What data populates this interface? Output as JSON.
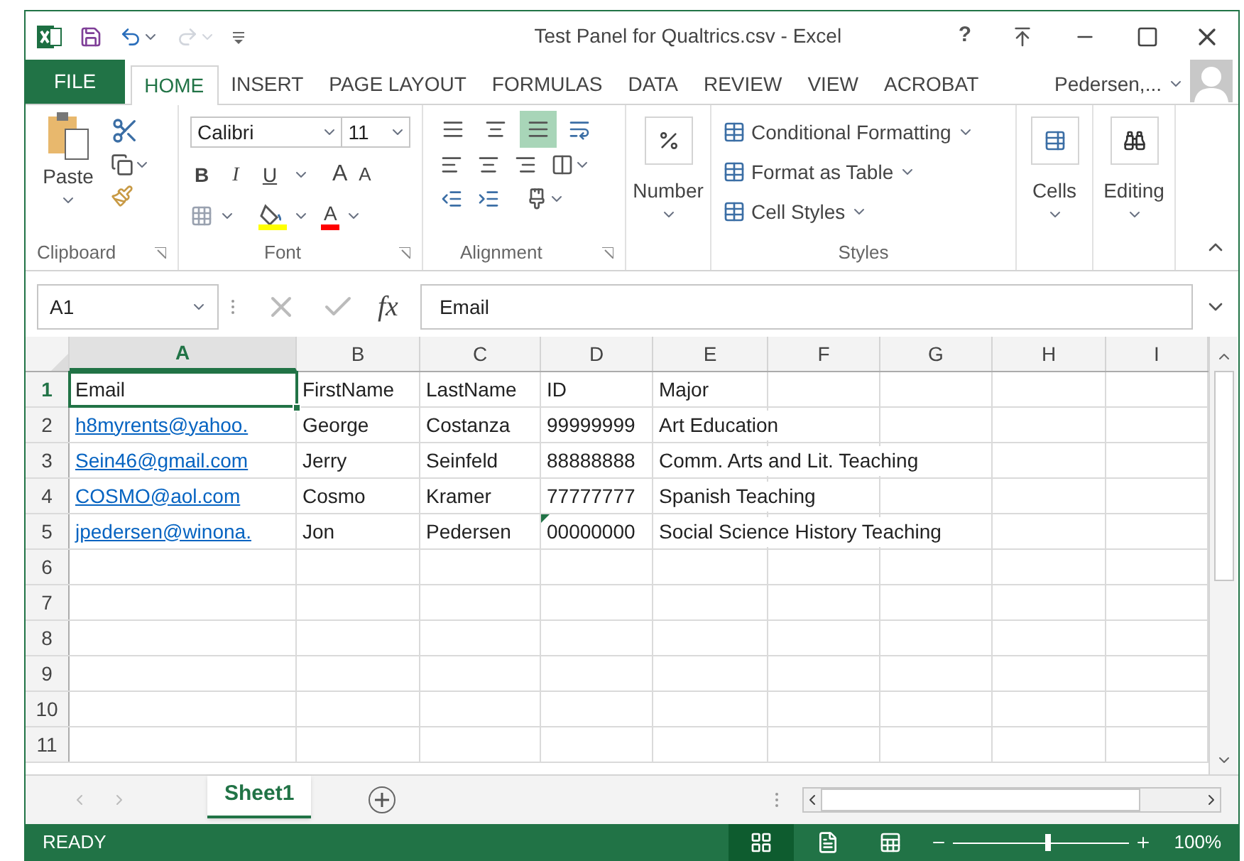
{
  "window": {
    "title": "Test Panel for Qualtrics.csv - Excel",
    "help": "?"
  },
  "ribbon_tabs": [
    {
      "label": "FILE",
      "kind": "file",
      "selected": false
    },
    {
      "label": "HOME",
      "kind": "tab",
      "selected": true
    },
    {
      "label": "INSERT",
      "kind": "tab",
      "selected": false
    },
    {
      "label": "PAGE LAYOUT",
      "kind": "tab",
      "selected": false
    },
    {
      "label": "FORMULAS",
      "kind": "tab",
      "selected": false
    },
    {
      "label": "DATA",
      "kind": "tab",
      "selected": false
    },
    {
      "label": "REVIEW",
      "kind": "tab",
      "selected": false
    },
    {
      "label": "VIEW",
      "kind": "tab",
      "selected": false
    },
    {
      "label": "ACROBAT",
      "kind": "tab",
      "selected": false
    }
  ],
  "account": {
    "name": "Pedersen,..."
  },
  "ribbon": {
    "clipboard": {
      "paste": "Paste",
      "label": "Clipboard"
    },
    "font": {
      "name": "Calibri",
      "size": "11",
      "bold": "B",
      "italic": "I",
      "underline": "U",
      "grow": "A",
      "shrink": "A",
      "color_letter": "A",
      "label": "Font"
    },
    "alignment": {
      "label": "Alignment",
      "vertical": [
        {
          "selected": false
        },
        {
          "selected": false
        },
        {
          "selected": true
        }
      ]
    },
    "number": {
      "label": "Number"
    },
    "styles": {
      "items": [
        "Conditional Formatting",
        "Format as Table",
        "Cell Styles"
      ],
      "label": "Styles"
    },
    "cells": {
      "label": "Cells"
    },
    "editing": {
      "label": "Editing"
    }
  },
  "formula_bar": {
    "name_box": "A1",
    "fx": "fx",
    "value": "Email"
  },
  "sheet": {
    "columns": [
      {
        "letter": "A",
        "selected": true
      },
      {
        "letter": "B",
        "selected": false
      },
      {
        "letter": "C",
        "selected": false
      },
      {
        "letter": "D",
        "selected": false
      },
      {
        "letter": "E",
        "selected": false
      },
      {
        "letter": "F",
        "selected": false
      },
      {
        "letter": "G",
        "selected": false
      },
      {
        "letter": "H",
        "selected": false
      },
      {
        "letter": "I",
        "selected": false
      }
    ],
    "rows": [
      {
        "number": "1",
        "selected": true,
        "email_link": false,
        "id_flagged": false,
        "cells": [
          "Email",
          "FirstName",
          "LastName",
          "ID",
          "Major"
        ]
      },
      {
        "number": "2",
        "selected": false,
        "email_link": true,
        "id_flagged": false,
        "cells": [
          "h8myrents@yahoo.",
          "George",
          "Costanza",
          "99999999",
          "Art Education"
        ]
      },
      {
        "number": "3",
        "selected": false,
        "email_link": true,
        "id_flagged": false,
        "cells": [
          "Sein46@gmail.com",
          "Jerry",
          "Seinfeld",
          "88888888",
          "Comm. Arts and Lit. Teaching"
        ]
      },
      {
        "number": "4",
        "selected": false,
        "email_link": true,
        "id_flagged": false,
        "cells": [
          "COSMO@aol.com",
          "Cosmo",
          "Kramer",
          "77777777",
          "Spanish Teaching"
        ]
      },
      {
        "number": "5",
        "selected": false,
        "email_link": true,
        "id_flagged": true,
        "cells": [
          "jpedersen@winona.",
          "Jon",
          "Pedersen",
          "00000000",
          "Social Science History Teaching"
        ]
      },
      {
        "number": "6",
        "selected": false
      },
      {
        "number": "7",
        "selected": false
      },
      {
        "number": "8",
        "selected": false
      },
      {
        "number": "9",
        "selected": false
      },
      {
        "number": "10",
        "selected": false
      },
      {
        "number": "11",
        "selected": false
      }
    ]
  },
  "sheet_tabs": [
    {
      "label": "Sheet1",
      "selected": true
    }
  ],
  "status_bar": {
    "status": "READY",
    "zoom": "100%",
    "level": 0.54
  }
}
